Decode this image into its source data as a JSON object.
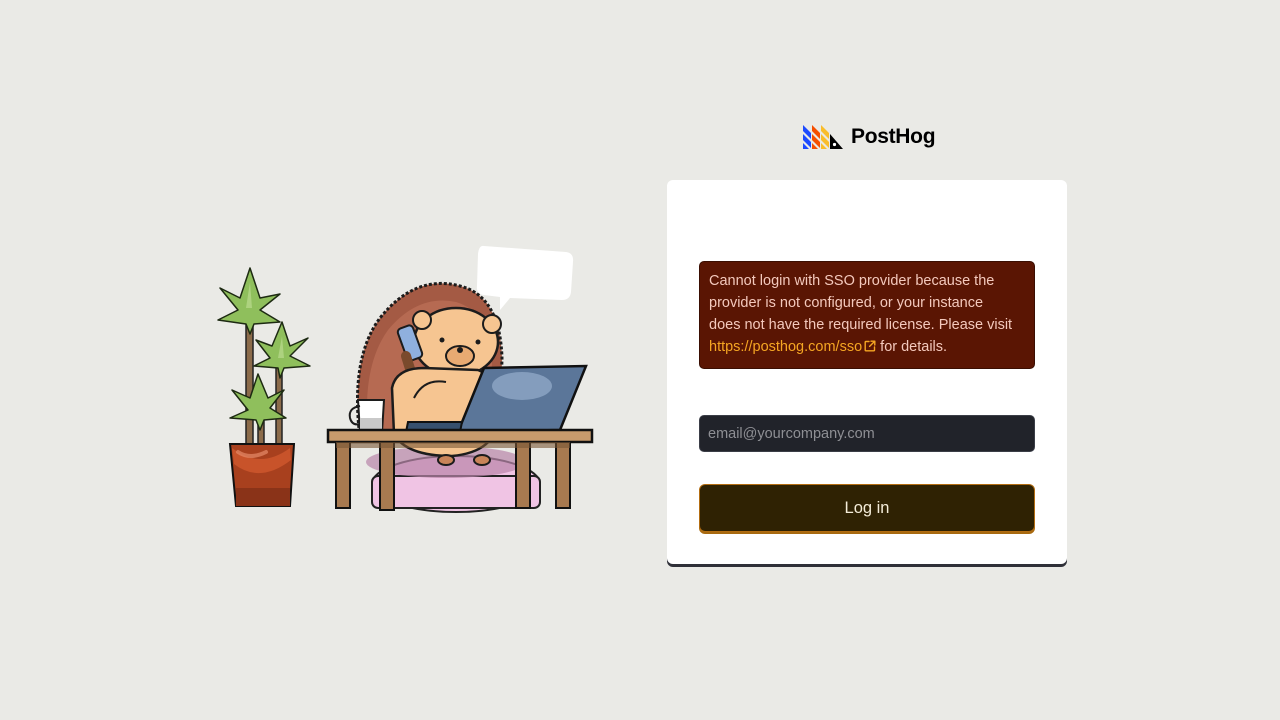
{
  "brand": {
    "name": "PostHog",
    "logo_icon": "posthog-hedgehog-logo-mark",
    "colors": {
      "blue": "#1d4aff",
      "orange": "#f54e00",
      "yellow": "#f9bd2b",
      "black": "#000000"
    }
  },
  "illustration": {
    "icon": "hedgehog-on-phone-at-desk-illustration"
  },
  "login_card": {
    "error": {
      "text_before": "Cannot login with SSO provider because the provider is not configured, or your instance does not have the required license. Please visit ",
      "link_text": "https://posthog.com/sso",
      "link_icon": "external-link-icon",
      "text_after": " for details."
    },
    "email": {
      "placeholder": "email@yourcompany.com",
      "value": ""
    },
    "login_button_label": "Log in"
  },
  "colors": {
    "background": "#eaeae6",
    "card": "#ffffff",
    "error_bg": "#5a1503",
    "error_text": "#f4c9bd",
    "link": "#f5a623",
    "input_bg": "#21232a",
    "button_bg": "#2f2203",
    "button_border": "#b36d12"
  }
}
